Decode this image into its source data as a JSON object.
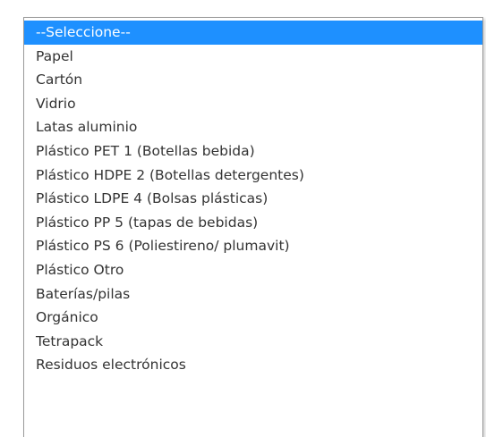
{
  "dropdown": {
    "options": [
      {
        "label": "--Seleccione--",
        "selected": true
      },
      {
        "label": "Papel"
      },
      {
        "label": "Cartón"
      },
      {
        "label": "Vidrio"
      },
      {
        "label": "Latas aluminio"
      },
      {
        "label": "Plástico PET 1 (Botellas bebida)"
      },
      {
        "label": "Plástico HDPE 2 (Botellas detergentes)"
      },
      {
        "label": "Plástico LDPE 4 (Bolsas plásticas)"
      },
      {
        "label": "Plástico PP 5 (tapas de bebidas)"
      },
      {
        "label": "Plástico PS 6 (Poliestireno/ plumavit)"
      },
      {
        "label": "Plástico Otro"
      },
      {
        "label": "Baterías/pilas"
      },
      {
        "label": "Orgánico"
      },
      {
        "label": "Tetrapack"
      },
      {
        "label": "Residuos electrónicos"
      }
    ],
    "highlight_color": "#1e90ff"
  }
}
